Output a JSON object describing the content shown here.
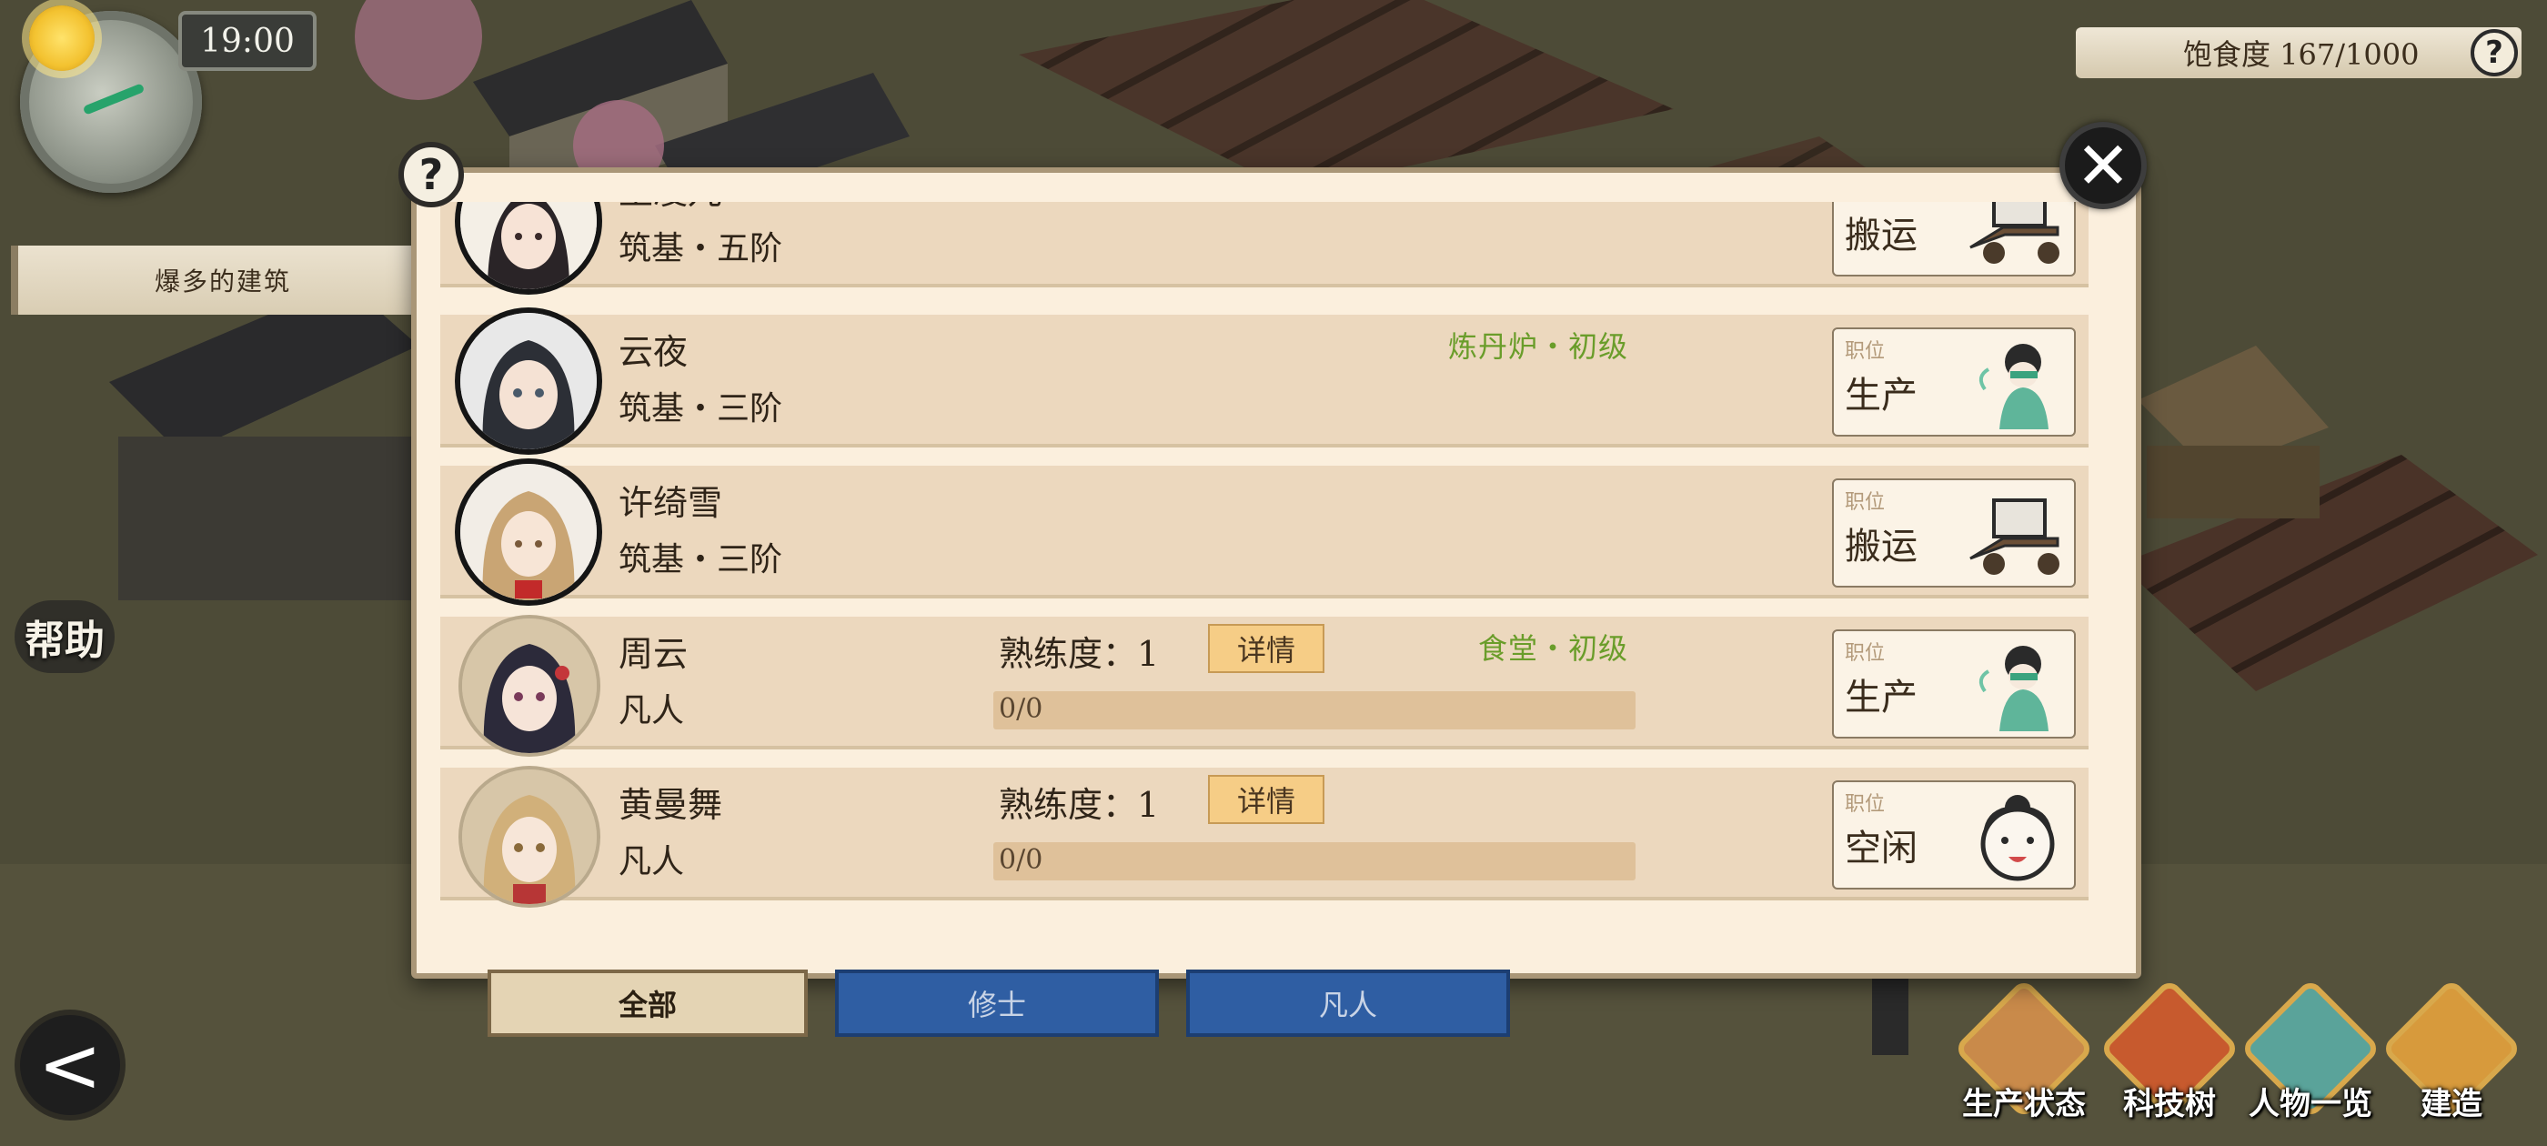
{
  "hud": {
    "time": "19:00",
    "building_tag": "爆多的建筑",
    "help_label": "帮助",
    "satiety": "饱食度 167/1000",
    "help_symbol": "?",
    "back_symbol": "<"
  },
  "dialog": {
    "help_symbol": "?",
    "close_symbol": "✕",
    "job_caption": "职位",
    "prof_label": "熟练度：",
    "detail_label": "详情",
    "rows": [
      {
        "name": "王凌儿",
        "rank": "筑基・五阶",
        "job": "搬运",
        "job_icon": "cart-icon",
        "facility": "",
        "avatar": "ink"
      },
      {
        "name": "云夜",
        "rank": "筑基・三阶",
        "job": "生产",
        "job_icon": "worker-icon",
        "facility": "炼丹炉・初级",
        "avatar": "ink"
      },
      {
        "name": "许绮雪",
        "rank": "筑基・三阶",
        "job": "搬运",
        "job_icon": "cart-icon",
        "facility": "",
        "avatar": "ink"
      },
      {
        "name": "周云",
        "rank": "凡人",
        "job": "生产",
        "job_icon": "worker-icon",
        "facility": "食堂・初级",
        "avatar": "plain",
        "proficiency": "1",
        "progress_text": "0/0",
        "progress": 0
      },
      {
        "name": "黄曼舞",
        "rank": "凡人",
        "job": "空闲",
        "job_icon": "idle-face-icon",
        "facility": "",
        "avatar": "plain",
        "proficiency": "1",
        "progress_text": "0/0",
        "progress": 0
      }
    ]
  },
  "tabs": [
    {
      "label": "全部",
      "active": true
    },
    {
      "label": "修士",
      "active": false
    },
    {
      "label": "凡人",
      "active": false
    }
  ],
  "bottom_menu": [
    {
      "label": "生产状态",
      "icon": "scroll-icon",
      "color": "#c98a4a"
    },
    {
      "label": "科技树",
      "icon": "tech-book-icon",
      "color": "#c75a2e"
    },
    {
      "label": "人物一览",
      "icon": "character-scroll-icon",
      "color": "#5aa39a"
    },
    {
      "label": "建造",
      "icon": "build-box-icon",
      "color": "#d79a3c"
    }
  ]
}
